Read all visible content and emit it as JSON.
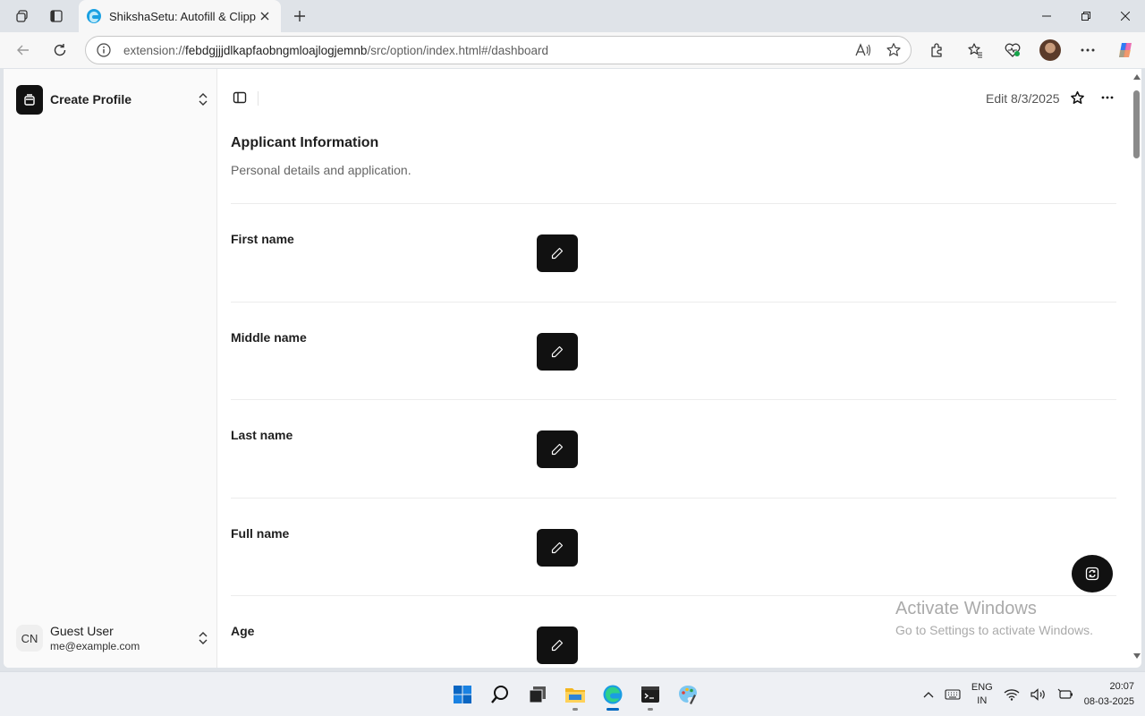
{
  "browser": {
    "tab_title": "ShikshaSetu: Autofill & Clipper",
    "url_scheme": "extension://",
    "url_host": "febdgjjjdlkapfaobngmloajlogjemnb",
    "url_path": "/src/option/index.html#/dashboard"
  },
  "sidebar": {
    "title": "Create Profile",
    "user": {
      "initials": "CN",
      "name": "Guest User",
      "email": "me@example.com"
    }
  },
  "header": {
    "edit_date": "Edit 8/3/2025"
  },
  "section": {
    "title": "Applicant Information",
    "description": "Personal details and application."
  },
  "fields": [
    {
      "label": "First name"
    },
    {
      "label": "Middle name"
    },
    {
      "label": "Last name"
    },
    {
      "label": "Full name"
    },
    {
      "label": "Age"
    }
  ],
  "watermark": {
    "title": "Activate Windows",
    "subtitle": "Go to Settings to activate Windows."
  },
  "taskbar": {
    "lang_top": "ENG",
    "lang_bottom": "IN",
    "time": "20:07",
    "date": "08-03-2025"
  },
  "colors": {
    "accent": "#111111",
    "taskbar_active": "#0067c0"
  }
}
